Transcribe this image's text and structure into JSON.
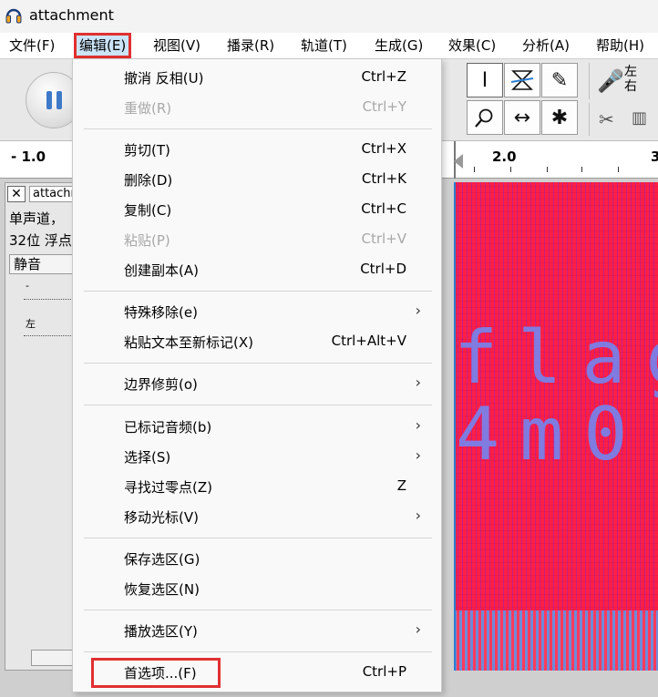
{
  "window": {
    "title": "attachment",
    "app_icon": "headphones-icon"
  },
  "menubar": {
    "items": [
      "文件(F)",
      "编辑(E)",
      "视图(V)",
      "播录(R)",
      "轨道(T)",
      "生成(G)",
      "效果(C)",
      "分析(A)",
      "帮助(H)"
    ],
    "active": "编辑(E)"
  },
  "toolbar": {
    "meter_label_1": "左",
    "meter_label_2": "右"
  },
  "ruler": {
    "labels": [
      "- 1.0",
      "2.0",
      "3"
    ]
  },
  "track": {
    "name": "attachment",
    "info_line1": "单声道，",
    "info_line2": "32位 浮点",
    "mute_label": "静音",
    "gain_label": "-",
    "pan_label": "左"
  },
  "waveform": {
    "text_line1": "flag",
    "text_line2": "4m0",
    "colors": {
      "background": "#ff1f44",
      "stripes": "#c2208a",
      "text": "#7f7be0",
      "cursor": "#2a7dd1"
    }
  },
  "edit_menu": {
    "items": [
      {
        "label": "撤消 反相(U)",
        "shortcut": "Ctrl+Z",
        "enabled": true
      },
      {
        "label": "重做(R)",
        "shortcut": "Ctrl+Y",
        "enabled": false
      },
      {
        "label": "剪切(T)",
        "shortcut": "Ctrl+X",
        "enabled": true
      },
      {
        "label": "删除(D)",
        "shortcut": "Ctrl+K",
        "enabled": true
      },
      {
        "label": "复制(C)",
        "shortcut": "Ctrl+C",
        "enabled": true
      },
      {
        "label": "粘贴(P)",
        "shortcut": "Ctrl+V",
        "enabled": false
      },
      {
        "label": "创建副本(A)",
        "shortcut": "Ctrl+D",
        "enabled": true
      },
      {
        "label": "特殊移除(e)",
        "shortcut": "",
        "submenu": true,
        "enabled": true
      },
      {
        "label": "粘贴文本至新标记(X)",
        "shortcut": "Ctrl+Alt+V",
        "enabled": true
      },
      {
        "label": "边界修剪(o)",
        "shortcut": "",
        "submenu": true,
        "enabled": true
      },
      {
        "label": "已标记音频(b)",
        "shortcut": "",
        "submenu": true,
        "enabled": true
      },
      {
        "label": "选择(S)",
        "shortcut": "",
        "submenu": true,
        "enabled": true
      },
      {
        "label": "寻找过零点(Z)",
        "shortcut": "Z",
        "enabled": true
      },
      {
        "label": "移动光标(V)",
        "shortcut": "",
        "submenu": true,
        "enabled": true
      },
      {
        "label": "保存选区(G)",
        "shortcut": "",
        "enabled": true
      },
      {
        "label": "恢复选区(N)",
        "shortcut": "",
        "enabled": true
      },
      {
        "label": "播放选区(Y)",
        "shortcut": "",
        "submenu": true,
        "enabled": true
      },
      {
        "label": "首选项...(F)",
        "shortcut": "Ctrl+P",
        "enabled": true
      }
    ],
    "submenu_arrow": "›"
  },
  "highlight_color": "#e03030"
}
